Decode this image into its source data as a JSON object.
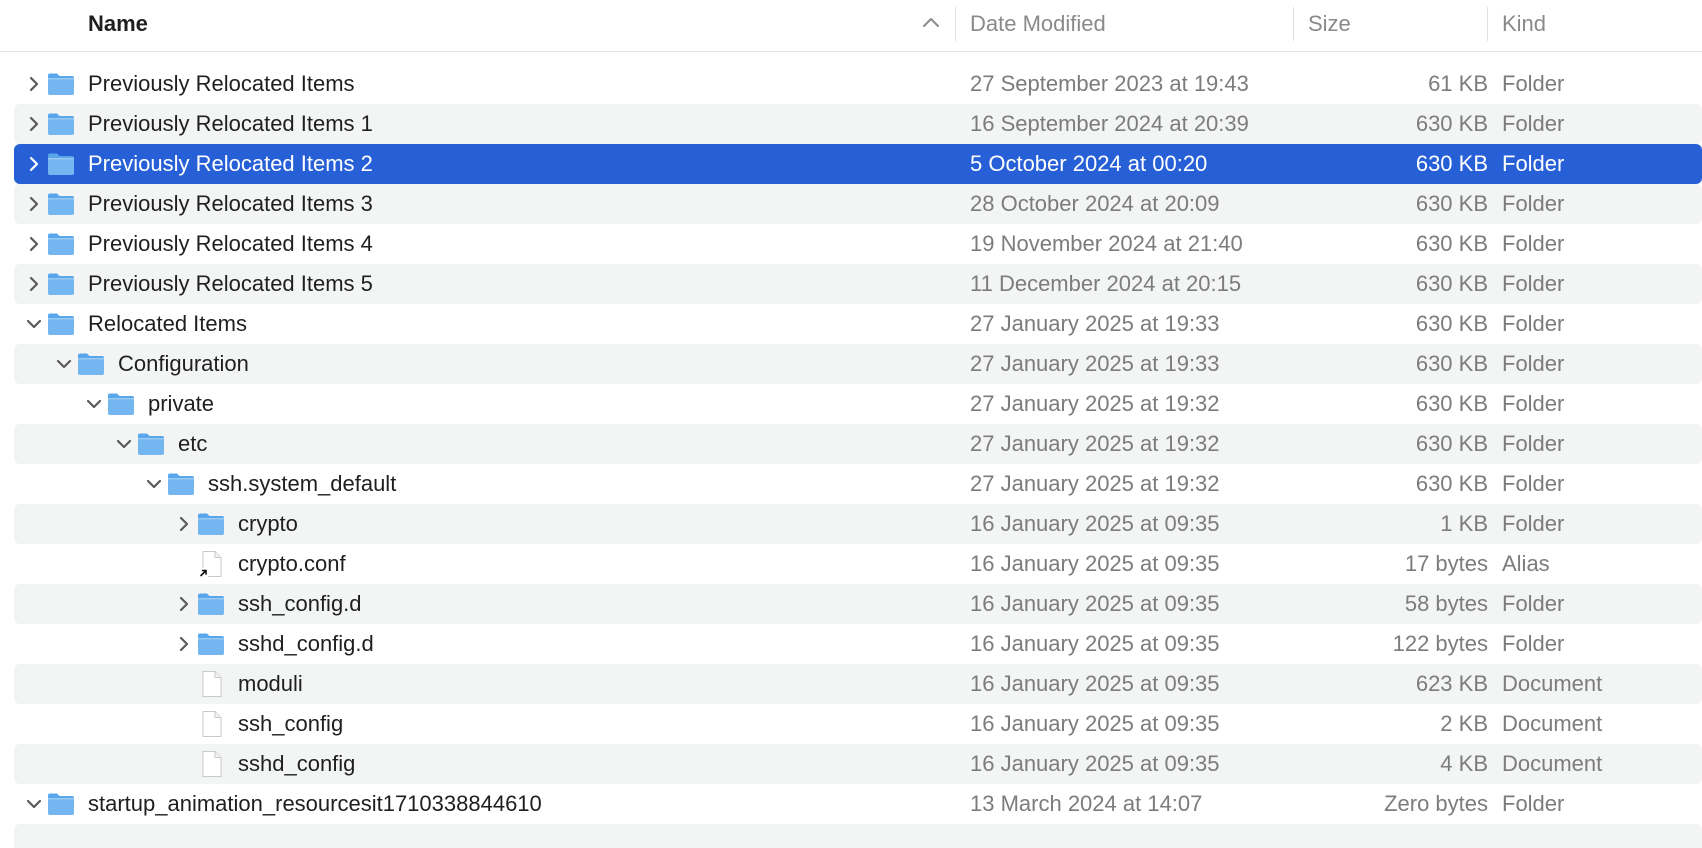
{
  "header": {
    "name": "Name",
    "date_modified": "Date Modified",
    "size": "Size",
    "kind": "Kind",
    "sorted_column": "Name",
    "sort_direction": "ascending"
  },
  "colors": {
    "selection": "#2760d6",
    "alt_row": "#f3f4f4",
    "folder_front": "#74b6ef",
    "folder_back": "#5aa6ea"
  },
  "rows": [
    {
      "name": "Previously Relocated Items",
      "date": "27 September 2023 at 19:43",
      "size": "61 KB",
      "kind": "Folder",
      "level": 0,
      "disclosure": "collapsed",
      "icon": "folder-icon"
    },
    {
      "name": "Previously Relocated Items 1",
      "date": "16 September 2024 at 20:39",
      "size": "630 KB",
      "kind": "Folder",
      "level": 0,
      "disclosure": "collapsed",
      "icon": "folder-icon"
    },
    {
      "name": "Previously Relocated Items 2",
      "date": "5 October 2024 at 00:20",
      "size": "630 KB",
      "kind": "Folder",
      "level": 0,
      "disclosure": "collapsed",
      "icon": "folder-icon",
      "selected": true
    },
    {
      "name": "Previously Relocated Items 3",
      "date": "28 October 2024 at 20:09",
      "size": "630 KB",
      "kind": "Folder",
      "level": 0,
      "disclosure": "collapsed",
      "icon": "folder-icon"
    },
    {
      "name": "Previously Relocated Items 4",
      "date": "19 November 2024 at 21:40",
      "size": "630 KB",
      "kind": "Folder",
      "level": 0,
      "disclosure": "collapsed",
      "icon": "folder-icon"
    },
    {
      "name": "Previously Relocated Items 5",
      "date": "11 December 2024 at 20:15",
      "size": "630 KB",
      "kind": "Folder",
      "level": 0,
      "disclosure": "collapsed",
      "icon": "folder-icon"
    },
    {
      "name": "Relocated Items",
      "date": "27 January 2025 at 19:33",
      "size": "630 KB",
      "kind": "Folder",
      "level": 0,
      "disclosure": "expanded",
      "icon": "folder-icon"
    },
    {
      "name": "Configuration",
      "date": "27 January 2025 at 19:33",
      "size": "630 KB",
      "kind": "Folder",
      "level": 1,
      "disclosure": "expanded",
      "icon": "folder-icon"
    },
    {
      "name": "private",
      "date": "27 January 2025 at 19:32",
      "size": "630 KB",
      "kind": "Folder",
      "level": 2,
      "disclosure": "expanded",
      "icon": "folder-icon"
    },
    {
      "name": "etc",
      "date": "27 January 2025 at 19:32",
      "size": "630 KB",
      "kind": "Folder",
      "level": 3,
      "disclosure": "expanded",
      "icon": "folder-icon"
    },
    {
      "name": "ssh.system_default",
      "date": "27 January 2025 at 19:32",
      "size": "630 KB",
      "kind": "Folder",
      "level": 4,
      "disclosure": "expanded",
      "icon": "folder-icon"
    },
    {
      "name": "crypto",
      "date": "16 January 2025 at 09:35",
      "size": "1 KB",
      "kind": "Folder",
      "level": 5,
      "disclosure": "collapsed",
      "icon": "folder-icon"
    },
    {
      "name": "crypto.conf",
      "date": "16 January 2025 at 09:35",
      "size": "17 bytes",
      "kind": "Alias",
      "level": 5,
      "disclosure": "none",
      "icon": "alias-icon"
    },
    {
      "name": "ssh_config.d",
      "date": "16 January 2025 at 09:35",
      "size": "58 bytes",
      "kind": "Folder",
      "level": 5,
      "disclosure": "collapsed",
      "icon": "folder-icon"
    },
    {
      "name": "sshd_config.d",
      "date": "16 January 2025 at 09:35",
      "size": "122 bytes",
      "kind": "Folder",
      "level": 5,
      "disclosure": "collapsed",
      "icon": "folder-icon"
    },
    {
      "name": "moduli",
      "date": "16 January 2025 at 09:35",
      "size": "623 KB",
      "kind": "Document",
      "level": 5,
      "disclosure": "none",
      "icon": "document-icon"
    },
    {
      "name": "ssh_config",
      "date": "16 January 2025 at 09:35",
      "size": "2 KB",
      "kind": "Document",
      "level": 5,
      "disclosure": "none",
      "icon": "document-icon"
    },
    {
      "name": "sshd_config",
      "date": "16 January 2025 at 09:35",
      "size": "4 KB",
      "kind": "Document",
      "level": 5,
      "disclosure": "none",
      "icon": "document-icon"
    },
    {
      "name": "startup_animation_resourcesit1710338844610",
      "date": "13 March 2024 at 14:07",
      "size": "Zero bytes",
      "kind": "Folder",
      "level": 0,
      "disclosure": "expanded",
      "icon": "folder-icon"
    }
  ]
}
